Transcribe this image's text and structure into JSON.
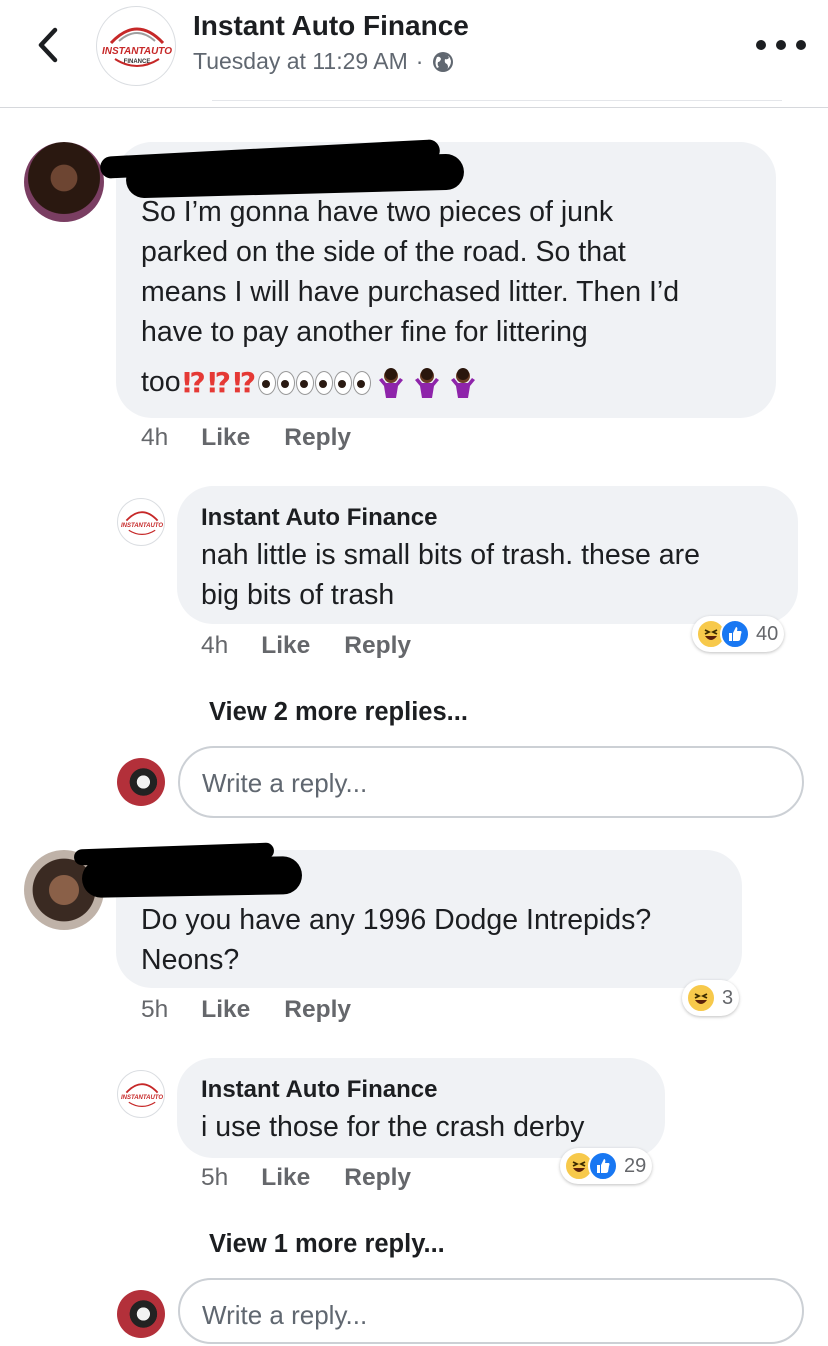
{
  "header": {
    "page_name": "Instant Auto Finance",
    "post_time": "Tuesday at 11:29 AM",
    "separator": "·",
    "logo_text_top": "INSTANTAUTO",
    "logo_text_bottom": "FINANCE",
    "icons": {
      "back": "chevron-left-icon",
      "privacy": "globe-icon",
      "more": "more-dots-icon"
    }
  },
  "comments": [
    {
      "text_lines": [
        "So I’m gonna have two pieces of junk",
        "parked on the side of the road. So that",
        "means I will have purchased litter. Then I’d",
        "have to pay another fine for littering"
      ],
      "last_line_text": "too",
      "last_line_emojis": "⁉️⁉️⁉️👀👀👀🤷🏾‍♀️🤷🏾‍♀️🤷🏾‍♀️",
      "time": "4h",
      "like_label": "Like",
      "reply_label": "Reply",
      "reply": {
        "name": "Instant Auto Finance",
        "text_lines": [
          "nah little is small bits of trash. these are",
          "big bits of trash"
        ],
        "time": "4h",
        "like_label": "Like",
        "reply_label": "Reply",
        "reaction_count": "40",
        "reactions": [
          "haha",
          "like"
        ]
      },
      "view_more": "View 2 more replies...",
      "write_reply_placeholder": "Write a reply..."
    },
    {
      "text_lines": [
        "Do you have any 1996 Dodge Intrepids?",
        "Neons?"
      ],
      "time": "5h",
      "like_label": "Like",
      "reply_label": "Reply",
      "reaction_count": "3",
      "reactions": [
        "haha"
      ],
      "reply": {
        "name": "Instant Auto Finance",
        "text_lines": [
          "i use those for the crash derby"
        ],
        "time": "5h",
        "like_label": "Like",
        "reply_label": "Reply",
        "reaction_count": "29",
        "reactions": [
          "haha",
          "like"
        ]
      },
      "view_more": "View 1 more reply...",
      "write_reply_placeholder": "Write a reply..."
    }
  ],
  "colors": {
    "bubble": "#f0f2f5",
    "like_blue": "#1877f2",
    "haha_yellow": "#f7c94b",
    "secondary_text": "#65676b"
  }
}
